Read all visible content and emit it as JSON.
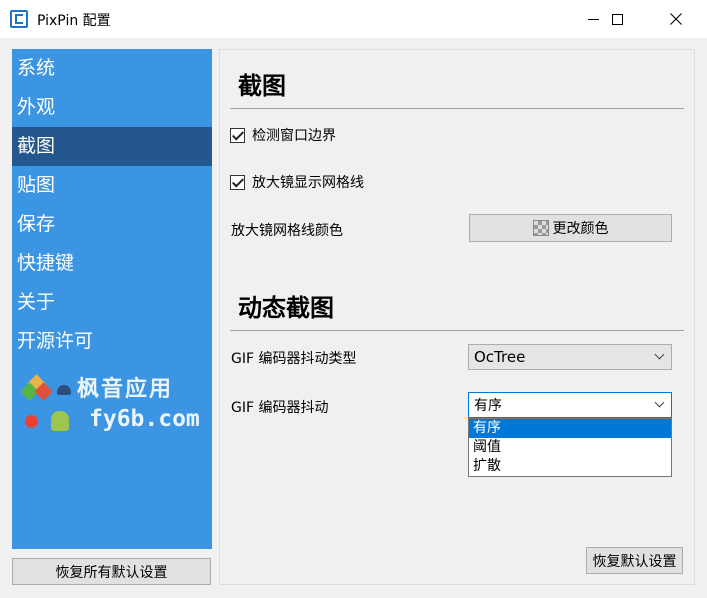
{
  "window": {
    "title": "PixPin 配置",
    "app_icon": "pixpin-logo-icon",
    "controls": [
      "minimize-icon",
      "maximize-icon",
      "close-icon"
    ]
  },
  "sidebar": {
    "items": [
      {
        "label": "系统"
      },
      {
        "label": "外观"
      },
      {
        "label": "截图",
        "active": true
      },
      {
        "label": "贴图"
      },
      {
        "label": "保存"
      },
      {
        "label": "快捷键"
      },
      {
        "label": "关于"
      },
      {
        "label": "开源许可"
      }
    ],
    "watermark": {
      "line1": "枫音应用",
      "line2": "fy6b.com"
    },
    "restore_all_label": "恢复所有默认设置"
  },
  "screenshot_section": {
    "title": "截图",
    "detect_borders": {
      "label": "检测窗口边界",
      "checked": true
    },
    "magnifier_grid": {
      "label": "放大镜显示网格线",
      "checked": true
    },
    "grid_color_label": "放大镜网格线颜色",
    "change_color_label": "更改颜色"
  },
  "animated_section": {
    "title": "动态截图",
    "dither_type_label": "GIF 编码器抖动类型",
    "dither_type_value": "OcTree",
    "dither_label": "GIF 编码器抖动",
    "dither_value": "有序",
    "dither_options": [
      "有序",
      "阈值",
      "扩散"
    ]
  },
  "restore_defaults_label": "恢复默认设置",
  "colors": {
    "sidebar_bg": "#3b95e2",
    "sidebar_active": "#24578d",
    "selection": "#0078d7"
  }
}
